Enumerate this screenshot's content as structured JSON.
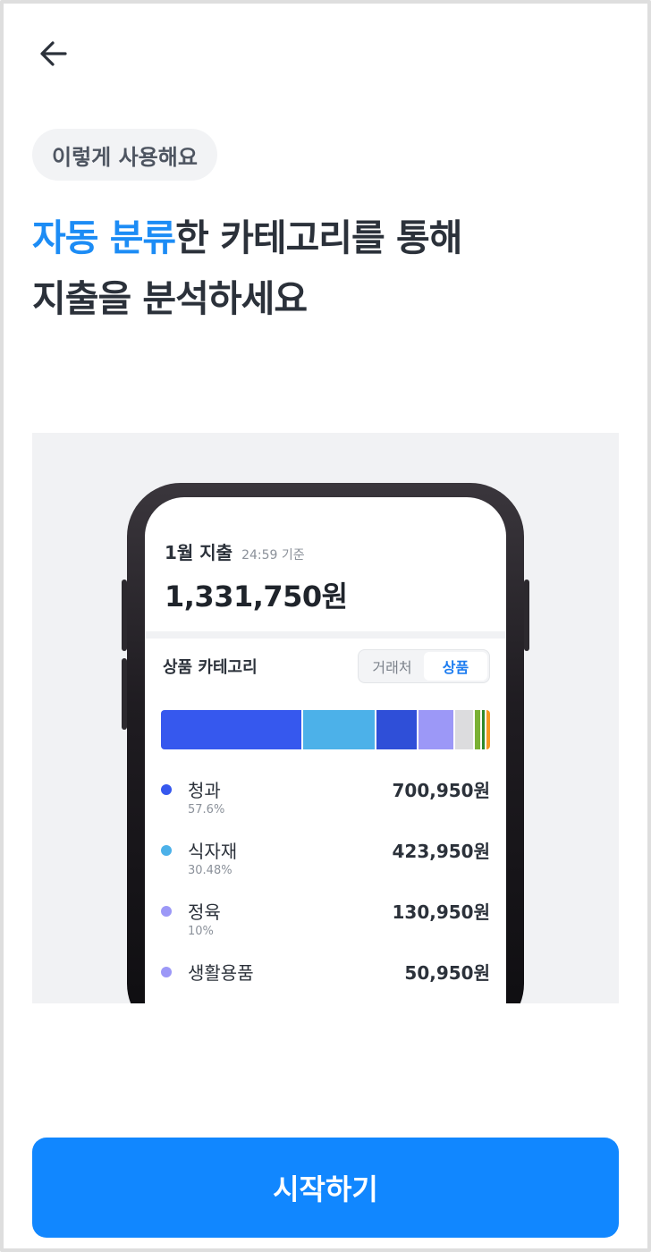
{
  "header": {
    "back_icon": "arrow-left-icon"
  },
  "badge": {
    "label": "이렇게 사용해요"
  },
  "headline": {
    "accent": "자동 분류",
    "line1_rest": "한 카테고리를 통해",
    "line2": "지출을 분석하세요",
    "accent_color": "#1c8cf5"
  },
  "phone_screen": {
    "month_title": "1월 지출",
    "basis": "24:59 기준",
    "total": "1,331,750원",
    "category_title": "상품 카테고리",
    "toggle": {
      "option_vendor": "거래처",
      "option_product": "상품",
      "selected": "상품"
    },
    "breakdown_bar": [
      {
        "color": "#3658ee",
        "share": 43.5
      },
      {
        "color": "#4cb1e9",
        "share": 22.1
      },
      {
        "color": "#2f4fd8",
        "share": 12.5
      },
      {
        "color": "#9c98f7",
        "share": 10.6
      },
      {
        "color": "#dcdcde",
        "share": 5.7
      },
      {
        "color": "#7ab134",
        "share": 1.6
      },
      {
        "color": "#2f8a2c",
        "share": 0.8
      },
      {
        "color": "#f59a23",
        "share": 1.1
      }
    ],
    "categories": [
      {
        "name": "청과",
        "percent": "57.6%",
        "amount": "700,950원",
        "color": "#3658ee"
      },
      {
        "name": "식자재",
        "percent": "30.48%",
        "amount": "423,950원",
        "color": "#4cb1e9"
      },
      {
        "name": "정육",
        "percent": "10%",
        "amount": "130,950원",
        "color": "#9c98f7"
      },
      {
        "name": "생활용품",
        "percent": "",
        "amount": "50,950원",
        "color": "#9c98f7"
      }
    ]
  },
  "cta": {
    "label": "시작하기",
    "color": "#1187ff"
  }
}
